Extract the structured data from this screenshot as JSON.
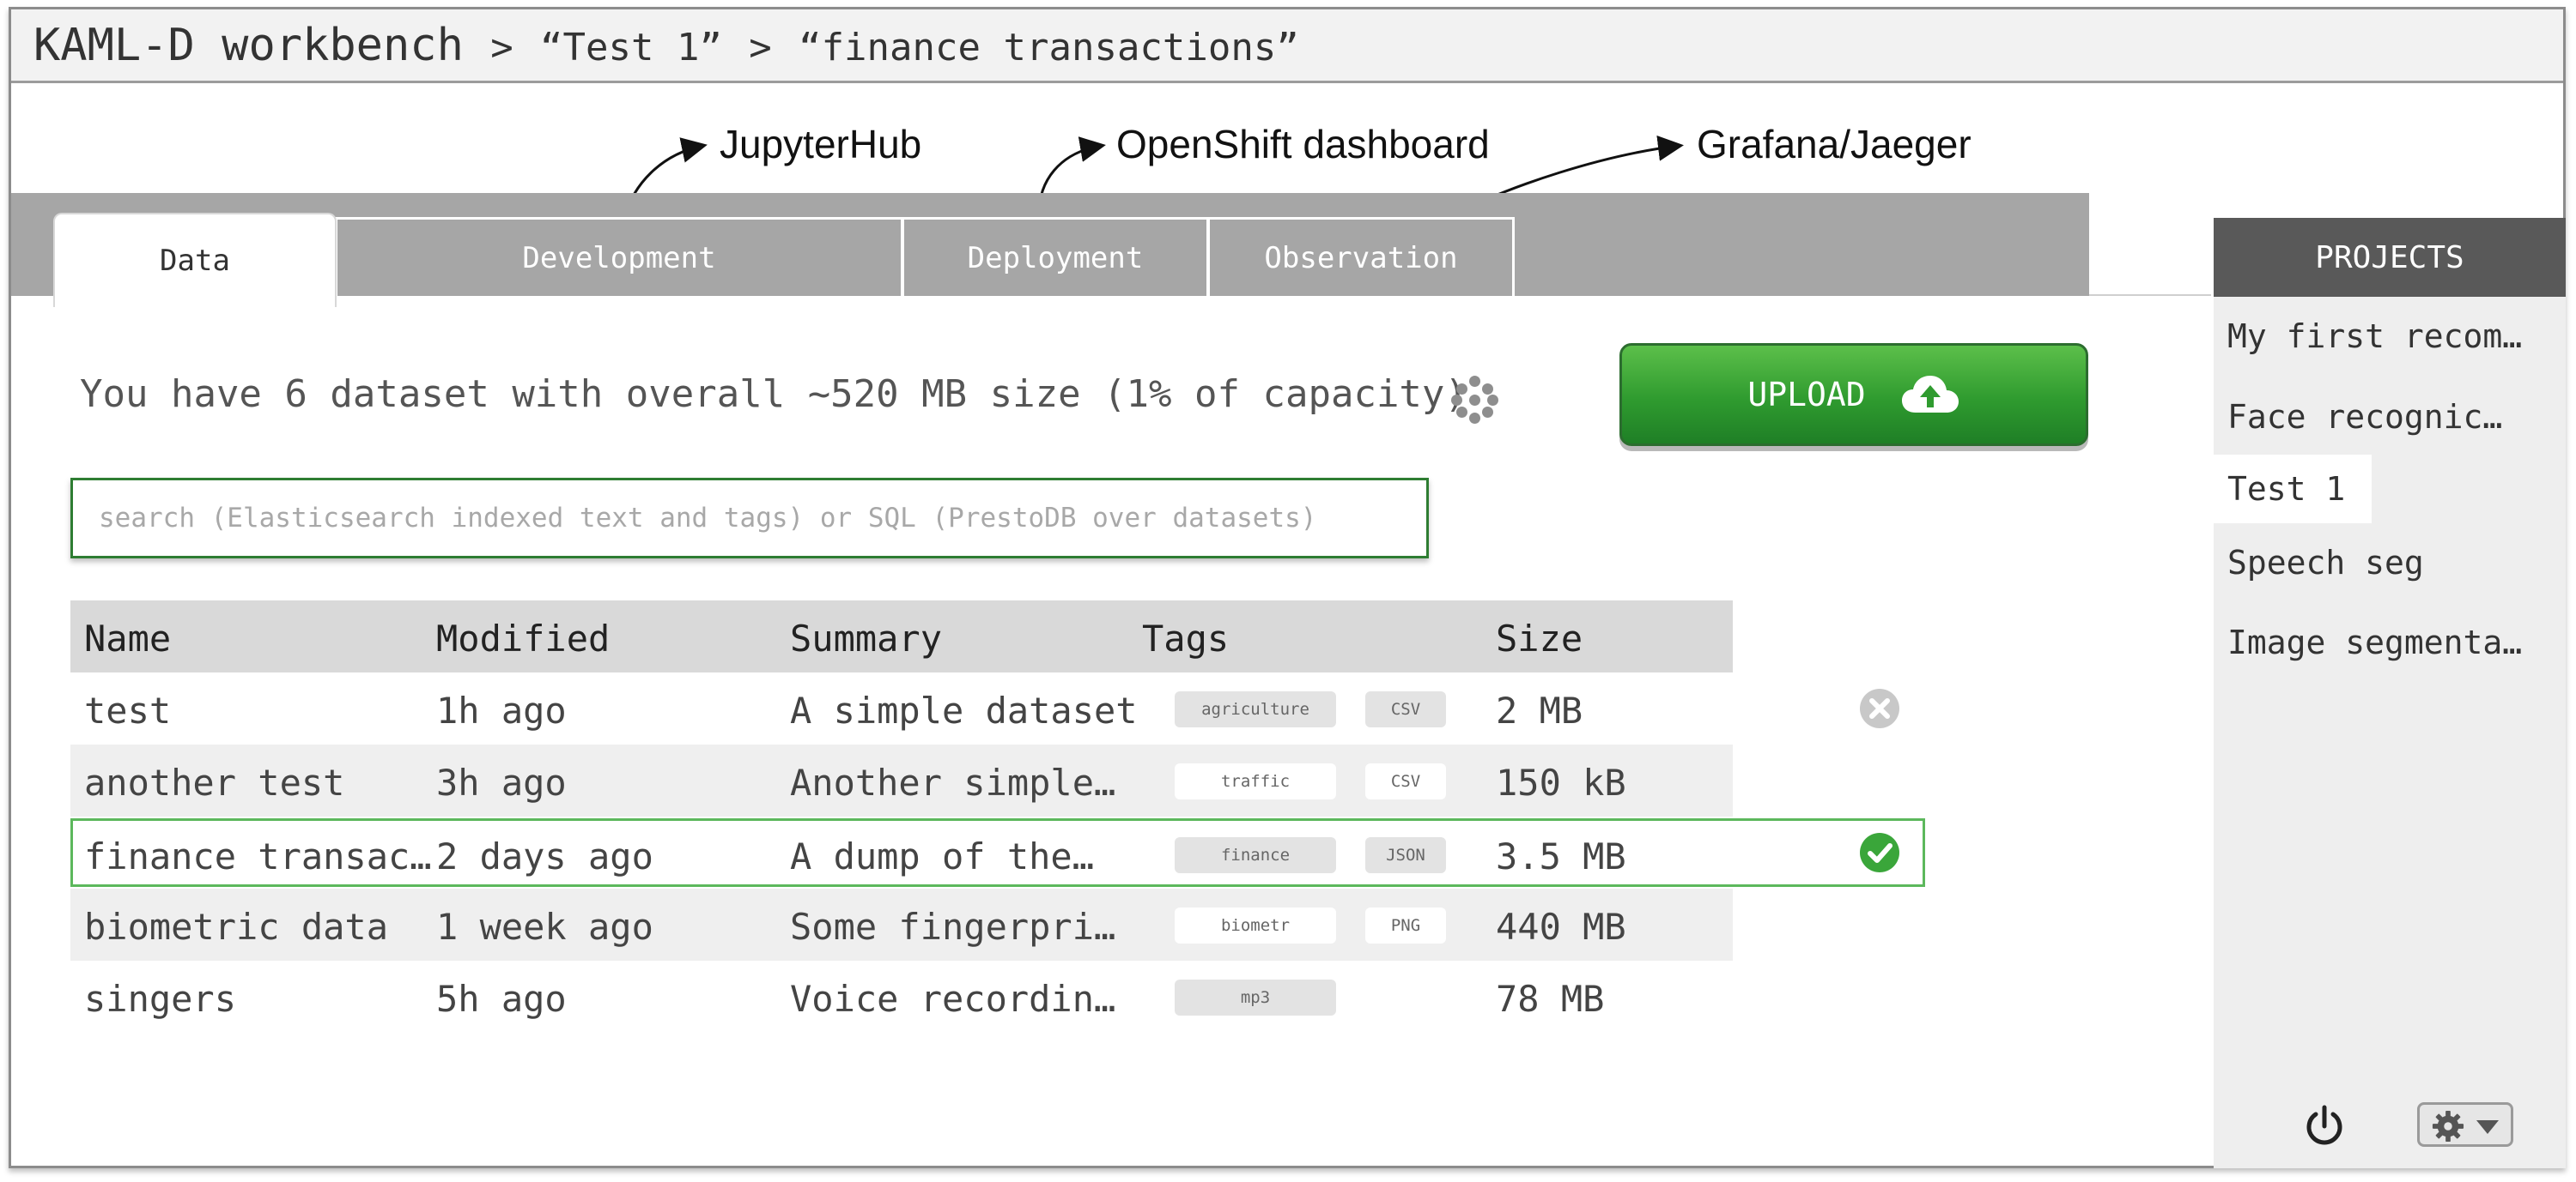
{
  "window": {
    "app_title": "KAML-D workbench",
    "separator_1": ">",
    "crumb_project": "“Test 1”",
    "separator_2": ">",
    "crumb_dataset": "“finance transactions”"
  },
  "annotations": {
    "development": "JupyterHub",
    "deployment": "OpenShift dashboard",
    "observation": "Grafana/Jaeger"
  },
  "tabs": [
    {
      "label": "Data",
      "active": true
    },
    {
      "label": "Development",
      "active": false
    },
    {
      "label": "Deployment",
      "active": false
    },
    {
      "label": "Observation",
      "active": false
    }
  ],
  "summary": {
    "text": "You have 6 dataset with overall ~520 MB size (1% of capacity)"
  },
  "upload": {
    "label": "UPLOAD",
    "icon": "cloud-upload-icon",
    "color": "#2f9b2f"
  },
  "search": {
    "value": "",
    "placeholder": "search (Elasticsearch indexed text and tags) or SQL (PrestoDB over datasets)"
  },
  "table": {
    "columns": [
      "Name",
      "Modified",
      "Summary",
      "Tags",
      "Size"
    ],
    "rows": [
      {
        "name": "test",
        "modified": "1h ago",
        "summary": "A simple dataset",
        "tags": [
          "agriculture",
          "CSV"
        ],
        "size": "2 MB",
        "status": "remove"
      },
      {
        "name": "another test",
        "modified": "3h ago",
        "summary": "Another simple…",
        "tags": [
          "traffic",
          "CSV"
        ],
        "size": "150 kB",
        "status": ""
      },
      {
        "name": "finance transac…",
        "modified": "2 days ago",
        "summary": "A dump of the…",
        "tags": [
          "finance",
          "JSON"
        ],
        "size": "3.5 MB",
        "status": "selected"
      },
      {
        "name": "biometric data",
        "modified": "1 week ago",
        "summary": "Some fingerpri…",
        "tags": [
          "biometr",
          "PNG"
        ],
        "size": "440 MB",
        "status": ""
      },
      {
        "name": "singers",
        "modified": "5h ago",
        "summary": "Voice recordin…",
        "tags": [
          "mp3"
        ],
        "size": "78 MB",
        "status": ""
      }
    ]
  },
  "sidebar": {
    "header": "PROJECTS",
    "items": [
      {
        "label": "My first recom…",
        "active": false
      },
      {
        "label": "Face recognic…",
        "active": false
      },
      {
        "label": "Test 1",
        "active": true
      },
      {
        "label": "Speech seg",
        "active": false
      },
      {
        "label": "Image segmenta…",
        "active": false
      }
    ]
  },
  "colors": {
    "selected_row_border": "#5cb85c",
    "check": "#3aa63a",
    "sidebar_header": "#595959"
  }
}
